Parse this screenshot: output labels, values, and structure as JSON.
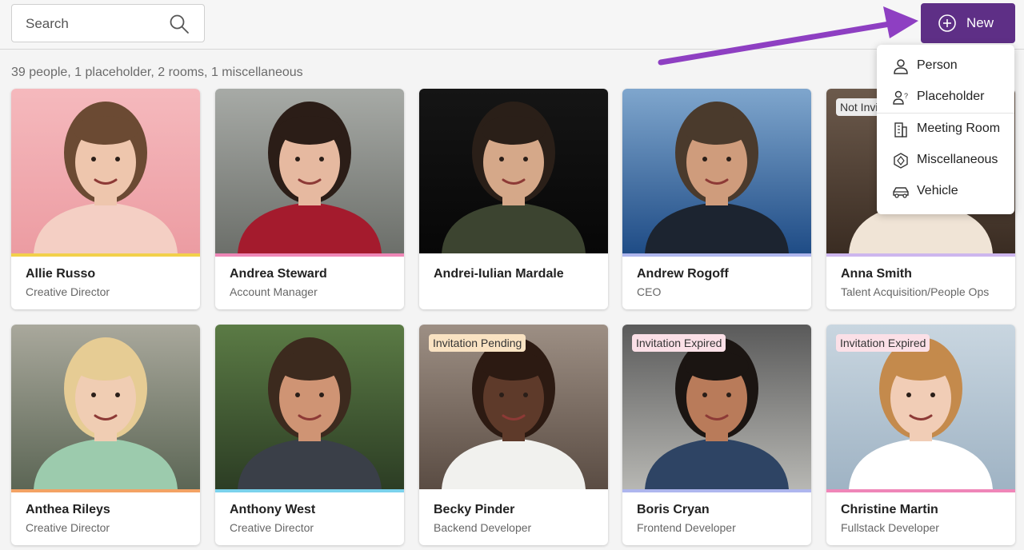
{
  "search": {
    "placeholder": "Search"
  },
  "new_button": {
    "label": "New",
    "color": "#5e2f86"
  },
  "summary": "39 people, 1 placeholder, 2 rooms, 1 miscellaneous",
  "new_menu": {
    "items": [
      {
        "label": "Person",
        "icon": "person-icon"
      },
      {
        "label": "Placeholder",
        "icon": "placeholder-icon"
      },
      {
        "label": "Meeting Room",
        "icon": "building-icon"
      },
      {
        "label": "Miscellaneous",
        "icon": "hexagon-icon"
      },
      {
        "label": "Vehicle",
        "icon": "car-icon"
      }
    ]
  },
  "people": [
    {
      "name": "Allie Russo",
      "title": "Creative Director",
      "stripe": "#f2d04a",
      "badge": ""
    },
    {
      "name": "Andrea Steward",
      "title": "Account Manager",
      "stripe": "#ee86b6",
      "badge": ""
    },
    {
      "name": "Andrei-Iulian Mardale",
      "title": "",
      "stripe": "#ffffff",
      "badge": ""
    },
    {
      "name": "Andrew Rogoff",
      "title": "CEO",
      "stripe": "#aeb6ee",
      "badge": ""
    },
    {
      "name": "Anna Smith",
      "title": "Talent Acquisition/People Ops",
      "stripe": "#cdb6ee",
      "badge": "Not Invi"
    },
    {
      "name": "Anthea Rileys",
      "title": "Creative Director",
      "stripe": "#f3a264",
      "badge": ""
    },
    {
      "name": "Anthony West",
      "title": "Creative Director",
      "stripe": "#7bd2ec",
      "badge": ""
    },
    {
      "name": "Becky Pinder",
      "title": "Backend Developer",
      "stripe": "#ffffff",
      "badge": "Invitation Pending"
    },
    {
      "name": "Boris Cryan",
      "title": "Frontend Developer",
      "stripe": "#aeb6ee",
      "badge": "Invitation Expired"
    },
    {
      "name": "Christine Martin",
      "title": "Fullstack Developer",
      "stripe": "#ef86b8",
      "badge": "Invitation Expired"
    }
  ],
  "badge_colors": {
    "Invitation Pending": "#f9e2c2",
    "Invitation Expired": "#fbe0e7",
    "Not Invi": "#ececec"
  }
}
